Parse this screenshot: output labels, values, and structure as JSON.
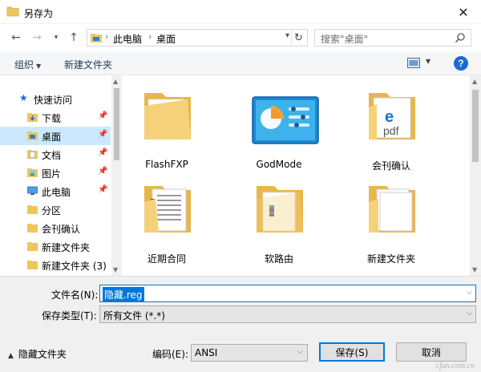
{
  "window": {
    "title": "另存为"
  },
  "nav": {
    "breadcrumb": [
      "此电脑",
      "桌面"
    ],
    "search_placeholder": "搜索\"桌面\""
  },
  "toolbar": {
    "organize_label": "组织",
    "new_folder_label": "新建文件夹",
    "help_glyph": "?"
  },
  "sidebar": {
    "quick_access_label": "快速访问",
    "items": [
      {
        "label": "下载",
        "icon": "download-folder-icon",
        "pinned": true
      },
      {
        "label": "桌面",
        "icon": "desktop-folder-icon",
        "pinned": true,
        "selected": true
      },
      {
        "label": "文档",
        "icon": "documents-folder-icon",
        "pinned": true
      },
      {
        "label": "图片",
        "icon": "pictures-folder-icon",
        "pinned": true
      },
      {
        "label": "此电脑",
        "icon": "this-pc-icon",
        "pinned": true
      },
      {
        "label": "分区",
        "icon": "folder-icon",
        "pinned": false
      },
      {
        "label": "会刊确认",
        "icon": "folder-icon",
        "pinned": false
      },
      {
        "label": "新建文件夹",
        "icon": "folder-icon",
        "pinned": false
      },
      {
        "label": "新建文件夹 (3)",
        "icon": "folder-icon",
        "pinned": false
      }
    ]
  },
  "files": [
    {
      "name": "FlashFXP",
      "icon": "empty-folder-icon"
    },
    {
      "name": "GodMode",
      "icon": "control-panel-icon"
    },
    {
      "name": "会刊确认",
      "icon": "pdf-folder-icon"
    },
    {
      "name": "近期合同",
      "icon": "documents-folder-icon"
    },
    {
      "name": "软路由",
      "icon": "archive-folder-icon"
    },
    {
      "name": "新建文件夹",
      "icon": "files-folder-icon"
    }
  ],
  "form": {
    "filename_label": "文件名(N):",
    "filename_value": "隐藏.reg",
    "filetype_label": "保存类型(T):",
    "filetype_value": "所有文件  (*.*)",
    "hide_folders_label": "隐藏文件夹",
    "encoding_label": "编码(E):",
    "encoding_value": "ANSI",
    "save_label": "保存(S)",
    "cancel_label": "取消"
  },
  "watermark": "cfan.com.cn",
  "colors": {
    "accent": "#0078d7",
    "selection": "#cce8ff",
    "folder": "#f0c65a",
    "help": "#1b6bd4"
  }
}
